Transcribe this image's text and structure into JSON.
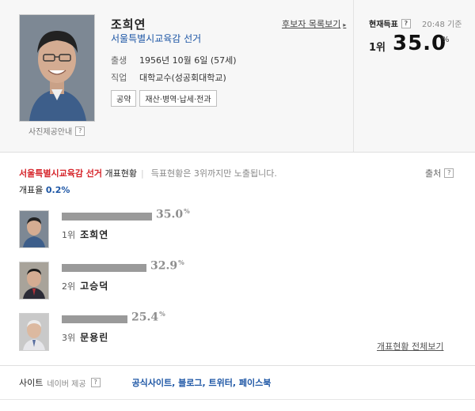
{
  "profile": {
    "name": "조희연",
    "race": "서울특별시교육감 선거",
    "birth_label": "출생",
    "birth_value": "1956년 10월 6일 (57세)",
    "job_label": "직업",
    "job_value": "대학교수(성공회대학교)",
    "tags": [
      "공약",
      "재산·병역·납세·전과"
    ],
    "photo_caption": "사진제공안내",
    "list_link": "후보자 목록보기"
  },
  "current_votes": {
    "title": "현재득표",
    "time": "20:48 기준",
    "rank": "1위",
    "percent": "35.0",
    "percent_sign": "%"
  },
  "count_section": {
    "race": "서울특별시교육감 선거",
    "title": "개표현황",
    "note": "득표현황은 3위까지만 노출됩니다.",
    "source": "출처",
    "rate_label": "개표율",
    "rate_value": "0.2%"
  },
  "chart_data": {
    "type": "bar",
    "categories": [
      "조희연",
      "고승덕",
      "문용린"
    ],
    "values": [
      35.0,
      32.9,
      25.4
    ],
    "ranks": [
      "1위",
      "2위",
      "3위"
    ],
    "value_labels": [
      "35.0",
      "32.9",
      "25.4"
    ],
    "unit": "%"
  },
  "full_link": "개표현황 전체보기",
  "site": {
    "label": "사이트",
    "sub": "네이버 제공",
    "links": "공식사이트, 블로그, 트위터, 페이스북"
  },
  "colors": {
    "race_blue": "#1d56a5",
    "race_red": "#d6252b",
    "bar_gray": "#9a9a9a"
  }
}
